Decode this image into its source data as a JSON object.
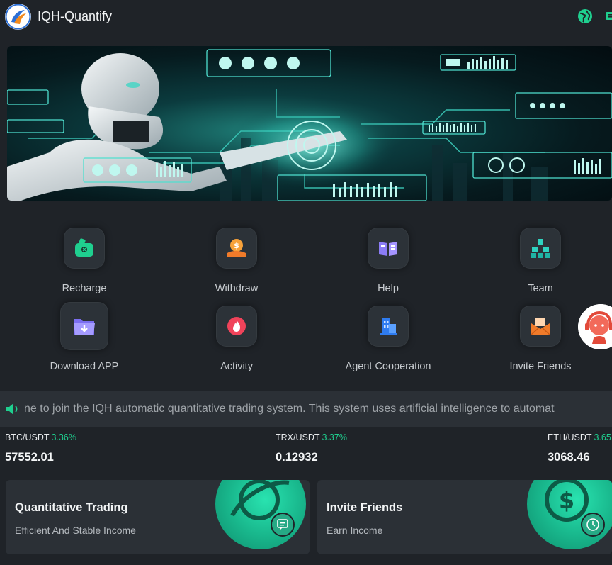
{
  "header": {
    "title": "IQH-Quantify",
    "logo_icon": "iqh-logo-icon",
    "language_icon": "globe-icon",
    "message_icon": "message-icon"
  },
  "banner": {
    "description_icon": "ai-robot-banner"
  },
  "menu": {
    "items": [
      {
        "label": "Recharge",
        "icon": "wallet-icon"
      },
      {
        "label": "Withdraw",
        "icon": "coin-bag-icon"
      },
      {
        "label": "Help",
        "icon": "book-icon"
      },
      {
        "label": "Team",
        "icon": "hierarchy-icon"
      },
      {
        "label": "Download APP",
        "icon": "download-folder-icon"
      },
      {
        "label": "Activity",
        "icon": "flame-icon"
      },
      {
        "label": "Agent Cooperation",
        "icon": "building-icon"
      },
      {
        "label": "Invite Friends",
        "icon": "envelope-icon"
      }
    ]
  },
  "support": {
    "icon": "customer-service-icon"
  },
  "notice": {
    "icon": "speaker-icon",
    "text": "ne to join the IQH automatic quantitative trading system. This system uses artificial intelligence to automat"
  },
  "tickers": [
    {
      "pair": "BTC/USDT",
      "change": "3.36%",
      "price": "57552.01"
    },
    {
      "pair": "TRX/USDT",
      "change": "3.37%",
      "price": "0.12932"
    },
    {
      "pair": "ETH/USDT",
      "change": "3.65",
      "price": "3068.46"
    }
  ],
  "cards": [
    {
      "title": "Quantitative Trading",
      "subtitle": "Efficient And Stable Income",
      "icon": "planet-icon",
      "badge_icon": "chat-icon"
    },
    {
      "title": "Invite Friends",
      "subtitle": "Earn Income",
      "icon": "dollar-coin-icon",
      "badge_icon": "clock-icon"
    }
  ],
  "colors": {
    "background": "#1f2328",
    "panel": "#2b3036",
    "accent_green": "#1fcf8f",
    "teal": "#19b88d"
  }
}
